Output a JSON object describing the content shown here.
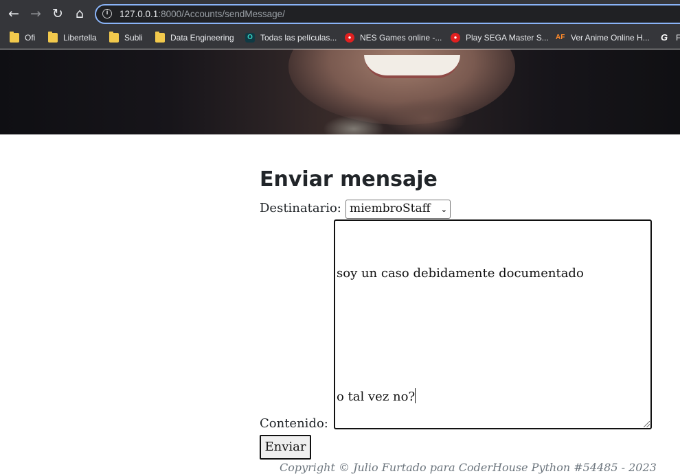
{
  "browser": {
    "url_host": "127.0.0.1",
    "url_rest": ":8000/Accounts/sendMessage/",
    "bookmarks": [
      {
        "label": "Ofi",
        "icon": "folder-icon"
      },
      {
        "label": "Libertella",
        "icon": "folder-icon"
      },
      {
        "label": "Subli",
        "icon": "folder-icon"
      },
      {
        "label": "Data Engineering",
        "icon": "folder-icon"
      },
      {
        "label": "Todas las películas...",
        "icon": "site-icon"
      },
      {
        "label": "NES Games online -...",
        "icon": "gamepad-icon"
      },
      {
        "label": "Play SEGA Master S...",
        "icon": "gamepad-icon"
      },
      {
        "label": "Ver Anime Online H...",
        "icon": "af-icon"
      },
      {
        "label": "F",
        "icon": "g-icon"
      }
    ],
    "todas_icon_glyph": "O",
    "af_icon_text": "AF",
    "g_icon_text": "G"
  },
  "form": {
    "title": "Enviar mensaje",
    "recipient_label": "Destinatario:",
    "recipient_value": "miembroStaff",
    "content_label": "Contenido:",
    "content_line1": "soy un caso debidamente documentado",
    "content_line2": "o tal vez no?",
    "submit_label": "Enviar"
  },
  "footer": {
    "text": "Copyright © Julio Furtado para CoderHouse Python #54485 - 2023"
  }
}
